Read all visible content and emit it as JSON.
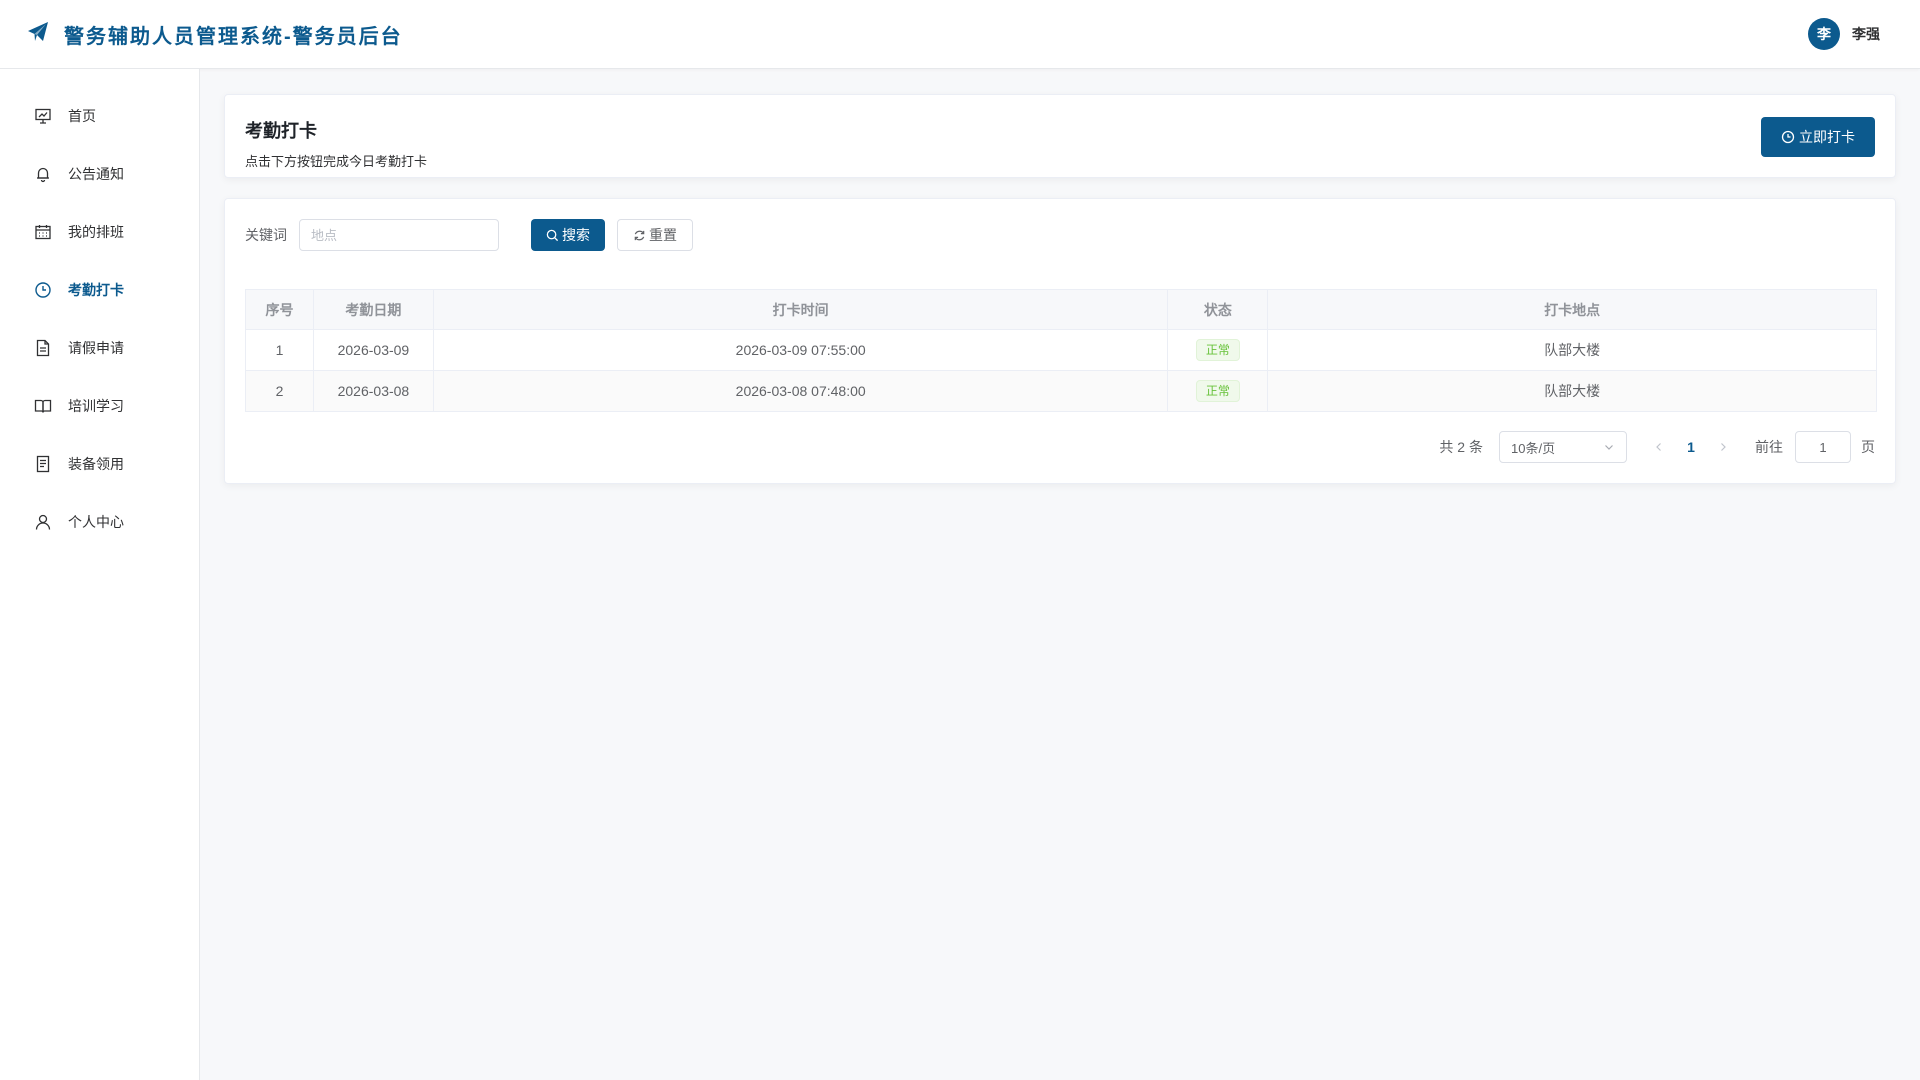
{
  "header": {
    "title": "警务辅助人员管理系统-警务员后台",
    "user_avatar": "李",
    "user_name": "李强"
  },
  "sidebar": {
    "items": [
      {
        "label": "首页",
        "icon": "presentation-icon"
      },
      {
        "label": "公告通知",
        "icon": "bell-icon"
      },
      {
        "label": "我的排班",
        "icon": "calendar-icon"
      },
      {
        "label": "考勤打卡",
        "icon": "clock-icon",
        "active": true
      },
      {
        "label": "请假申请",
        "icon": "document-icon"
      },
      {
        "label": "培训学习",
        "icon": "book-icon"
      },
      {
        "label": "装备领用",
        "icon": "list-document-icon"
      },
      {
        "label": "个人中心",
        "icon": "user-icon"
      }
    ]
  },
  "page": {
    "title": "考勤打卡",
    "subtitle": "点击下方按钮完成今日考勤打卡",
    "clock_in_button": "立即打卡"
  },
  "search": {
    "label": "关键词",
    "placeholder": "地点",
    "search_button": "搜索",
    "reset_button": "重置"
  },
  "table": {
    "columns": [
      "序号",
      "考勤日期",
      "打卡时间",
      "状态",
      "打卡地点"
    ],
    "rows": [
      {
        "index": "1",
        "date": "2026-03-09",
        "time": "2026-03-09 07:55:00",
        "status": "正常",
        "location": "队部大楼"
      },
      {
        "index": "2",
        "date": "2026-03-08",
        "time": "2026-03-08 07:48:00",
        "status": "正常",
        "location": "队部大楼"
      }
    ]
  },
  "pagination": {
    "total_text": "共 2 条",
    "page_size": "10条/页",
    "current_page": "1",
    "goto_label": "前往",
    "goto_value": "1",
    "page_suffix": "页"
  },
  "colors": {
    "primary": "#0c5a8e",
    "success": "#67c23a"
  }
}
